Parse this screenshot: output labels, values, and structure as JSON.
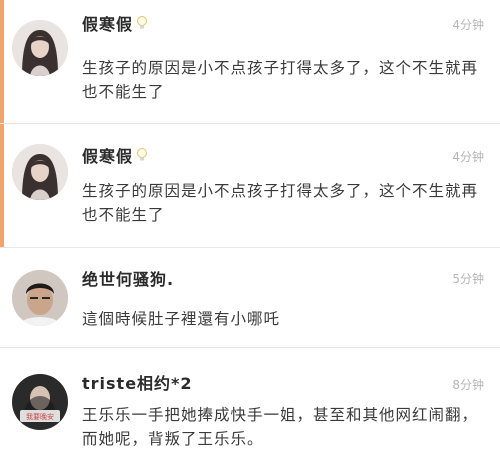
{
  "comments": [
    {
      "username": "假寒假",
      "has_bulb_badge": true,
      "time": "4分钟",
      "text": "生孩子的原因是小不点孩子打得太多了，这个不生就再也不能生了",
      "highlighted": true,
      "avatar": "avatar-woman-long-hair"
    },
    {
      "username": "假寒假",
      "has_bulb_badge": true,
      "time": "4分钟",
      "text": "生孩子的原因是小不点孩子打得太多了，这个不生就再也不能生了",
      "highlighted": true,
      "avatar": "avatar-woman-long-hair"
    },
    {
      "username": "绝世何骚狗.",
      "has_bulb_badge": false,
      "time": "5分钟",
      "text": "這個時候肚子裡還有小哪吒",
      "highlighted": false,
      "avatar": "avatar-man-portrait"
    },
    {
      "username": "triste相约*2",
      "has_bulb_badge": false,
      "time": "8分钟",
      "text": "王乐乐一手把她捧成快手一姐，甚至和其他网红闹翻，而她呢，背叛了王乐乐。",
      "highlighted": false,
      "avatar": "avatar-woman-dark",
      "avatar_caption": "我要晚安"
    }
  ],
  "colors": {
    "accent_bar": "#f0a36b",
    "time_text": "#b5b5b5",
    "divider": "#e6e6e6"
  }
}
